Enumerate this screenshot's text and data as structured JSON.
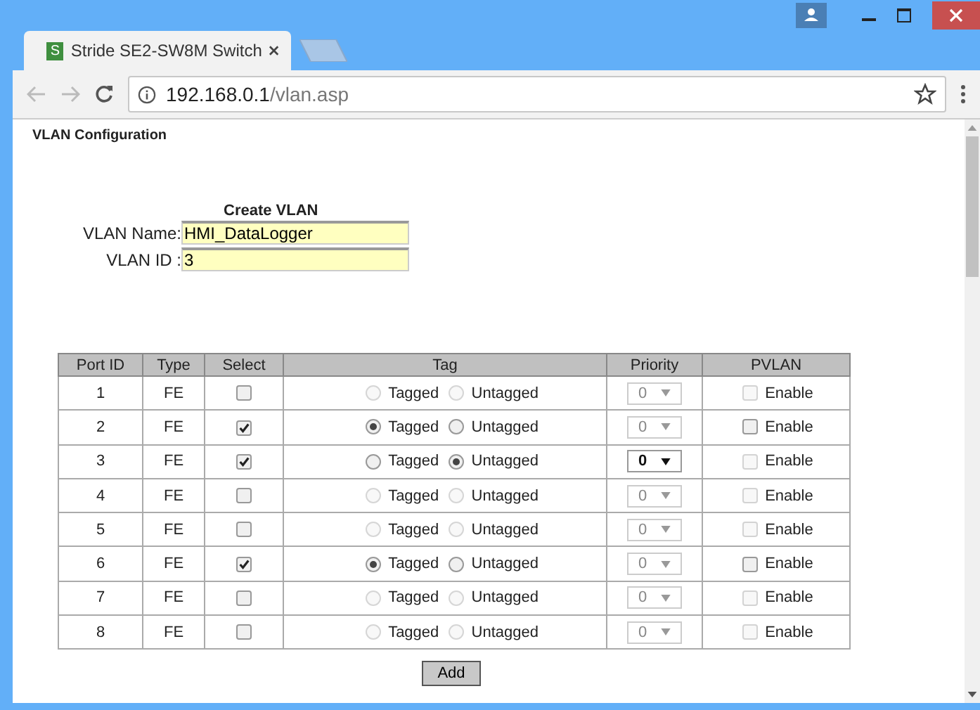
{
  "window": {
    "tab_title": "Stride SE2-SW8M Switch",
    "tab_logo": "S",
    "url_host": "192.168.0.1",
    "url_path": "/vlan.asp"
  },
  "page": {
    "heading": "VLAN Configuration",
    "form_title": "Create VLAN",
    "name_label": "VLAN Name:",
    "name_value": "HMI_DataLogger",
    "id_label": "VLAN ID :",
    "id_value": "3"
  },
  "table": {
    "columns": [
      "Port ID",
      "Type",
      "Select",
      "Tag",
      "Priority",
      "PVLAN"
    ],
    "rows": [
      {
        "port": "1",
        "type": "FE",
        "checked": false,
        "tag_disabled": true,
        "tagged": false,
        "untagged": false,
        "tagged_label": "Tagged",
        "untagged_label": "Untagged",
        "priority": "0",
        "priority_disabled": true,
        "pvlan_disabled": true,
        "pvlan_checked": false,
        "pvlan_label": "Enable"
      },
      {
        "port": "2",
        "type": "FE",
        "checked": true,
        "tag_disabled": false,
        "tagged": true,
        "untagged": false,
        "tagged_label": "Tagged",
        "untagged_label": "Untagged",
        "priority": "0",
        "priority_disabled": true,
        "pvlan_disabled": false,
        "pvlan_checked": false,
        "pvlan_label": "Enable"
      },
      {
        "port": "3",
        "type": "FE",
        "checked": true,
        "tag_disabled": false,
        "tagged": false,
        "untagged": true,
        "tagged_label": "Tagged",
        "untagged_label": "Untagged",
        "priority": "0",
        "priority_disabled": false,
        "pvlan_disabled": true,
        "pvlan_checked": false,
        "pvlan_label": "Enable"
      },
      {
        "port": "4",
        "type": "FE",
        "checked": false,
        "tag_disabled": true,
        "tagged": false,
        "untagged": false,
        "tagged_label": "Tagged",
        "untagged_label": "Untagged",
        "priority": "0",
        "priority_disabled": true,
        "pvlan_disabled": true,
        "pvlan_checked": false,
        "pvlan_label": "Enable"
      },
      {
        "port": "5",
        "type": "FE",
        "checked": false,
        "tag_disabled": true,
        "tagged": false,
        "untagged": false,
        "tagged_label": "Tagged",
        "untagged_label": "Untagged",
        "priority": "0",
        "priority_disabled": true,
        "pvlan_disabled": true,
        "pvlan_checked": false,
        "pvlan_label": "Enable"
      },
      {
        "port": "6",
        "type": "FE",
        "checked": true,
        "tag_disabled": false,
        "tagged": true,
        "untagged": false,
        "tagged_label": "Tagged",
        "untagged_label": "Untagged",
        "priority": "0",
        "priority_disabled": true,
        "pvlan_disabled": false,
        "pvlan_checked": false,
        "pvlan_label": "Enable"
      },
      {
        "port": "7",
        "type": "FE",
        "checked": false,
        "tag_disabled": true,
        "tagged": false,
        "untagged": false,
        "tagged_label": "Tagged",
        "untagged_label": "Untagged",
        "priority": "0",
        "priority_disabled": true,
        "pvlan_disabled": true,
        "pvlan_checked": false,
        "pvlan_label": "Enable"
      },
      {
        "port": "8",
        "type": "FE",
        "checked": false,
        "tag_disabled": true,
        "tagged": false,
        "untagged": false,
        "tagged_label": "Tagged",
        "untagged_label": "Untagged",
        "priority": "0",
        "priority_disabled": true,
        "pvlan_disabled": true,
        "pvlan_checked": false,
        "pvlan_label": "Enable"
      }
    ]
  },
  "add_button": "Add"
}
